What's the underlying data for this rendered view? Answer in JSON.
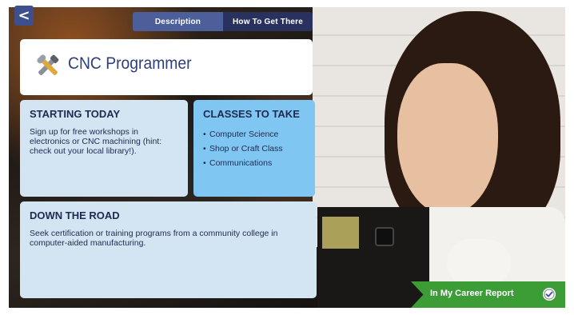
{
  "nav": {
    "back_glyph": "<"
  },
  "tabs": [
    {
      "label": "Description",
      "active": true
    },
    {
      "label": "How To Get There",
      "active": false
    }
  ],
  "career": {
    "title": "CNC Programmer",
    "icon": "tools-icon"
  },
  "starting_today": {
    "heading": "STARTING TODAY",
    "text": "Sign up for free workshops in electronics or CNC machining (hint: check out your local library!)."
  },
  "classes": {
    "heading": "CLASSES TO TAKE",
    "items": [
      "Computer Science",
      "Shop or Craft Class",
      "Communications"
    ]
  },
  "down_the_road": {
    "heading": "DOWN THE ROAD",
    "text": "Seek certification or training programs from a community college in computer-aided manufacturing."
  },
  "report_button": {
    "label": "In My Career Report",
    "icon": "checkmark-icon"
  },
  "colors": {
    "accent_blue": "#3d4f8d",
    "tab_active": "#4d5f9a",
    "tab_inactive": "#29325e",
    "card_light": "#d3e5f2",
    "card_classes": "#7fc6f2",
    "report_green": "#3c9d37",
    "title_text": "#2f3f77"
  }
}
